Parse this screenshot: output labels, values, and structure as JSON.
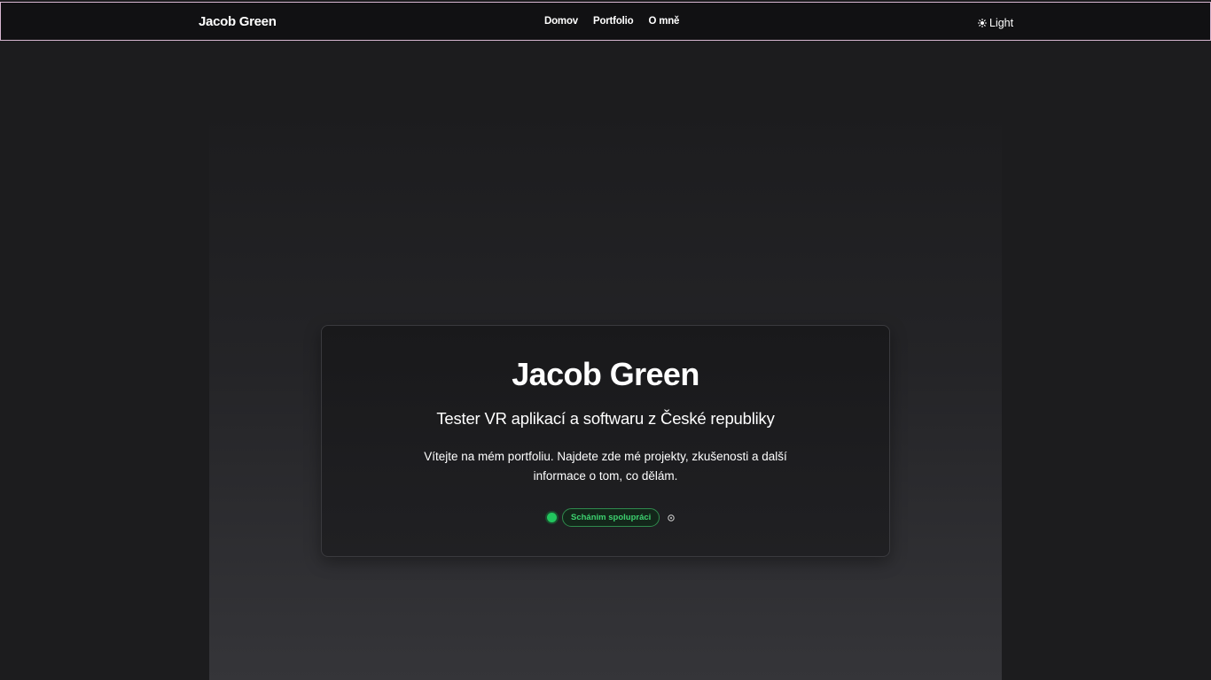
{
  "header": {
    "brand": "Jacob Green",
    "nav": [
      {
        "label": "Domov"
      },
      {
        "label": "Portfolio"
      },
      {
        "label": "O mně"
      }
    ],
    "theme_toggle": {
      "icon": "sun-icon",
      "label": "Light"
    }
  },
  "hero": {
    "title": "Jacob Green",
    "subtitle": "Tester VR aplikací a softwaru z České republiky",
    "description": "Vítejte na mém portfoliu. Najdete zde mé projekty, zkušenosti a další informace o tom, co dělám.",
    "status": {
      "badge": "Schánim spolupráci",
      "indicator_icon": "status-dot-icon",
      "info_icon": "info-icon"
    }
  },
  "colors": {
    "background": "#1c1c1e",
    "navbar": "#111113",
    "navbar_border": "#d6b6d0",
    "status_green": "#22c55e"
  }
}
